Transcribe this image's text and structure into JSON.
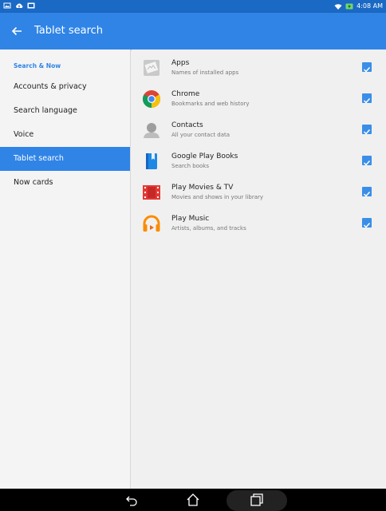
{
  "statusbar": {
    "time": "4:08 AM"
  },
  "appbar": {
    "title": "Tablet search"
  },
  "sidebar": {
    "header": "Search & Now",
    "items": [
      {
        "label": "Accounts & privacy",
        "active": false
      },
      {
        "label": "Search language",
        "active": false
      },
      {
        "label": "Voice",
        "active": false
      },
      {
        "label": "Tablet search",
        "active": true
      },
      {
        "label": "Now cards",
        "active": false
      }
    ]
  },
  "content": {
    "rows": [
      {
        "title": "Apps",
        "subtitle": "Names of installed apps",
        "icon": "apps-icon",
        "checked": true
      },
      {
        "title": "Chrome",
        "subtitle": "Bookmarks and web history",
        "icon": "chrome-icon",
        "checked": true
      },
      {
        "title": "Contacts",
        "subtitle": "All your contact data",
        "icon": "contacts-icon",
        "checked": true
      },
      {
        "title": "Google Play Books",
        "subtitle": "Search books",
        "icon": "play-books-icon",
        "checked": true
      },
      {
        "title": "Play Movies & TV",
        "subtitle": "Movies and shows in your library",
        "icon": "play-movies-icon",
        "checked": true
      },
      {
        "title": "Play Music",
        "subtitle": "Artists, albums, and tracks",
        "icon": "play-music-icon",
        "checked": true
      }
    ]
  },
  "colors": {
    "statusbar": "#1a69c4",
    "appbar": "#2f84e6",
    "accent": "#3a8ee8"
  }
}
